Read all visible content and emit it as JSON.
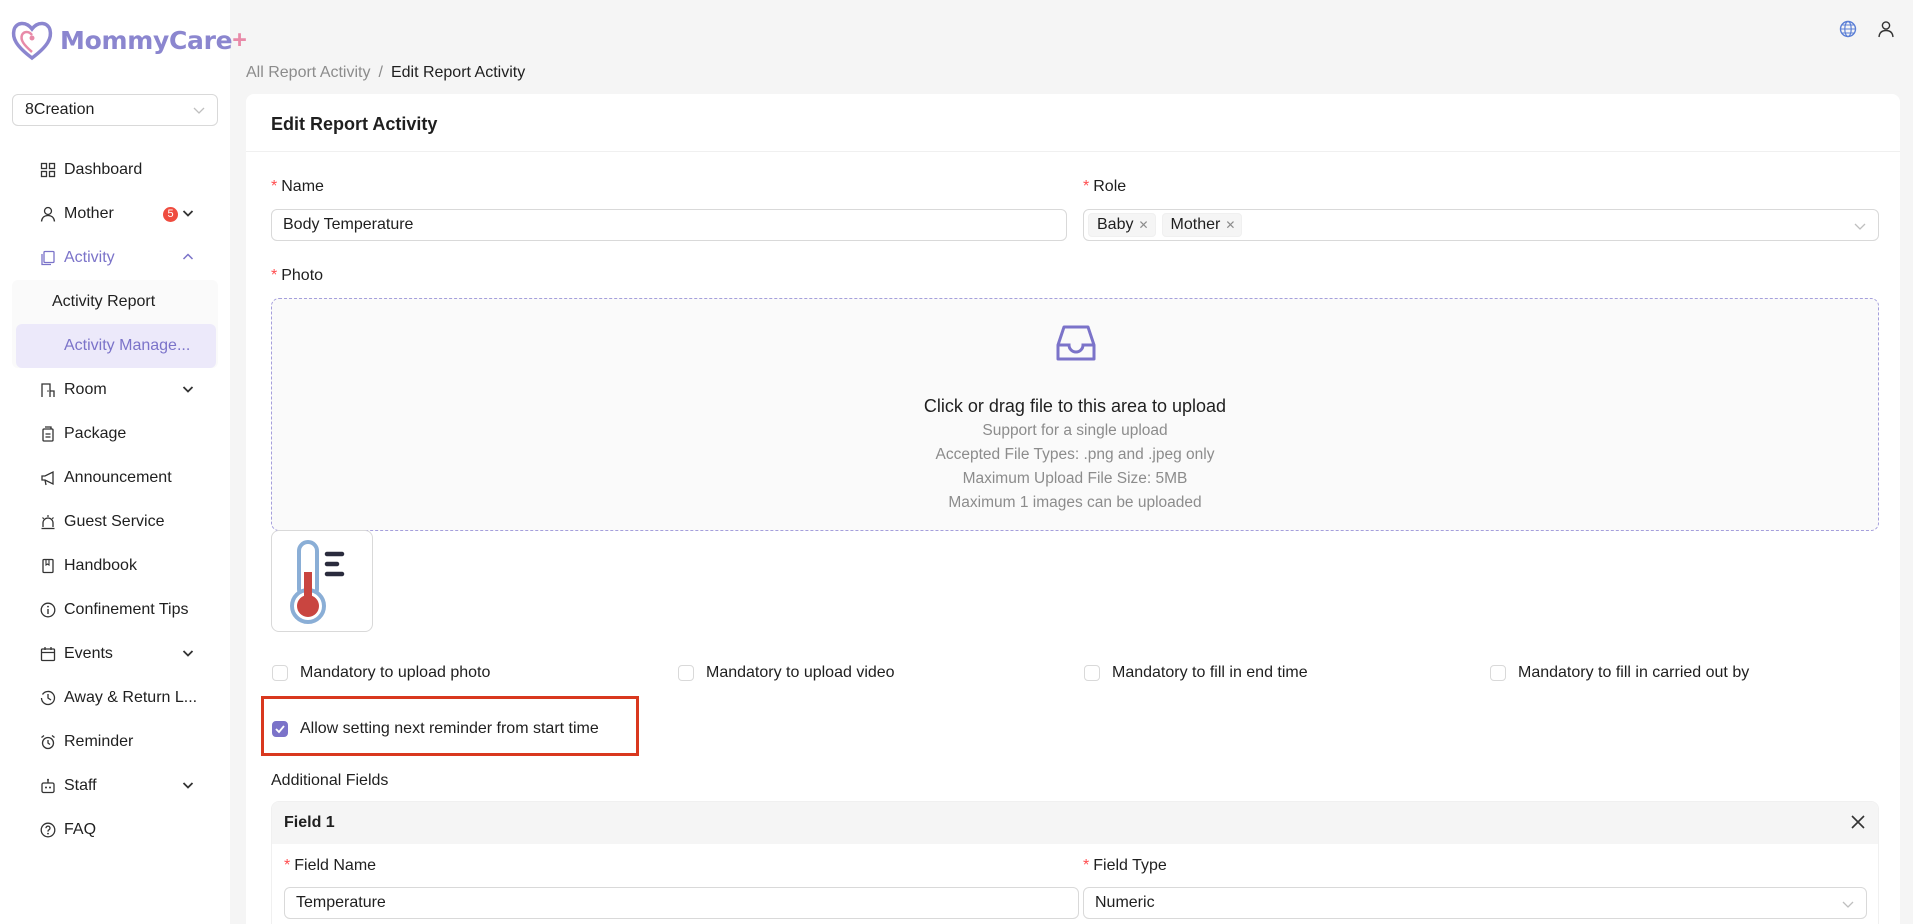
{
  "app": {
    "name": "MommyCare",
    "plus": "+"
  },
  "org_select": {
    "value": "8Creation"
  },
  "menu": [
    {
      "key": "dashboard",
      "label": "Dashboard"
    },
    {
      "key": "mother",
      "label": "Mother",
      "badge": "5"
    },
    {
      "key": "activity",
      "label": "Activity"
    },
    {
      "key": "room",
      "label": "Room"
    },
    {
      "key": "package",
      "label": "Package"
    },
    {
      "key": "announcement",
      "label": "Announcement"
    },
    {
      "key": "guest-service",
      "label": "Guest Service"
    },
    {
      "key": "handbook",
      "label": "Handbook"
    },
    {
      "key": "confinement-tips",
      "label": "Confinement Tips"
    },
    {
      "key": "events",
      "label": "Events"
    },
    {
      "key": "away-return",
      "label": "Away & Return L..."
    },
    {
      "key": "reminder",
      "label": "Reminder"
    },
    {
      "key": "staff",
      "label": "Staff"
    },
    {
      "key": "faq",
      "label": "FAQ"
    }
  ],
  "activity_submenu": [
    {
      "label": "Activity Report"
    },
    {
      "label": "Activity Manage..."
    }
  ],
  "breadcrumb": {
    "parent": "All Report Activity",
    "separator": "/",
    "current": "Edit Report Activity"
  },
  "form": {
    "title": "Edit Report Activity",
    "name_label": "Name",
    "name_value": "Body Temperature",
    "role_label": "Role",
    "role_tags": [
      "Baby",
      "Mother"
    ],
    "photo_label": "Photo",
    "upload": {
      "title": "Click or drag file to this area to upload",
      "hints": [
        "Support for a single upload",
        "Accepted File Types: .png and .jpeg only",
        "Maximum Upload File Size: 5MB",
        "Maximum 1 images can be uploaded"
      ]
    },
    "checkboxes": [
      {
        "label": "Mandatory to upload photo",
        "checked": false
      },
      {
        "label": "Mandatory to upload video",
        "checked": false
      },
      {
        "label": "Mandatory to fill in end time",
        "checked": false
      },
      {
        "label": "Mandatory to fill in carried out by",
        "checked": false
      }
    ],
    "reminder_checkbox": {
      "label": "Allow setting next reminder from start time",
      "checked": true
    },
    "additional_fields_title": "Additional Fields",
    "field1": {
      "title": "Field 1",
      "field_name_label": "Field Name",
      "field_name_value": "Temperature",
      "field_type_label": "Field Type",
      "field_type_value": "Numeric"
    }
  },
  "colors": {
    "accent": "#7b73c9",
    "highlight": "#d9381e",
    "badge": "#ef4c3f"
  }
}
